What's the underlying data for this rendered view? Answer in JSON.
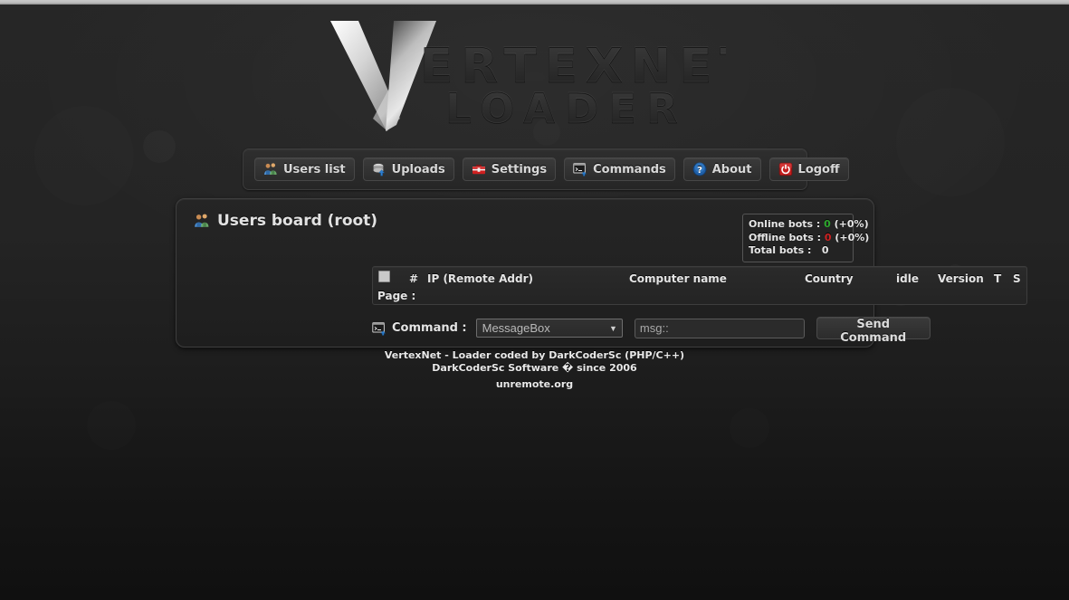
{
  "app": {
    "logo_primary": "V",
    "logo_line1": "ERTEXNET",
    "logo_line2": "LOADER"
  },
  "nav": {
    "items": [
      {
        "label": "Users list",
        "icon": "users-icon"
      },
      {
        "label": "Uploads",
        "icon": "upload-disk-icon"
      },
      {
        "label": "Settings",
        "icon": "toolbox-icon"
      },
      {
        "label": "Commands",
        "icon": "console-icon"
      },
      {
        "label": "About",
        "icon": "question-circle-icon"
      },
      {
        "label": "Logoff",
        "icon": "power-icon"
      }
    ]
  },
  "panel": {
    "title": "Users board (root)",
    "title_icon": "users-icon",
    "stats": {
      "online_label": "Online bots :",
      "online_value": "0",
      "online_percent": "(+0%)",
      "offline_label": "Offline bots :",
      "offline_value": "0",
      "offline_percent": "(+0%)",
      "total_label": "Total bots :",
      "total_value": "0",
      "online_color": "#2ea82e",
      "offline_color": "#cc2222"
    },
    "table": {
      "columns": [
        "#",
        "IP (Remote Addr)",
        "Computer name",
        "Country",
        "idle",
        "Version",
        "T",
        "S"
      ],
      "rows": [],
      "page_label": "Page :",
      "page_value": ""
    },
    "command": {
      "label": "Command :",
      "icon": "console-icon",
      "select_value": "MessageBox",
      "select_options": [
        "MessageBox"
      ],
      "input_value": "",
      "input_placeholder": "msg::",
      "send_label": "Send Command"
    }
  },
  "footer": {
    "line1": "VertexNet - Loader coded by DarkCoderSc (PHP/C++)",
    "line2": "DarkCoderSc Software � since 2006",
    "line3": "unremote.org"
  }
}
